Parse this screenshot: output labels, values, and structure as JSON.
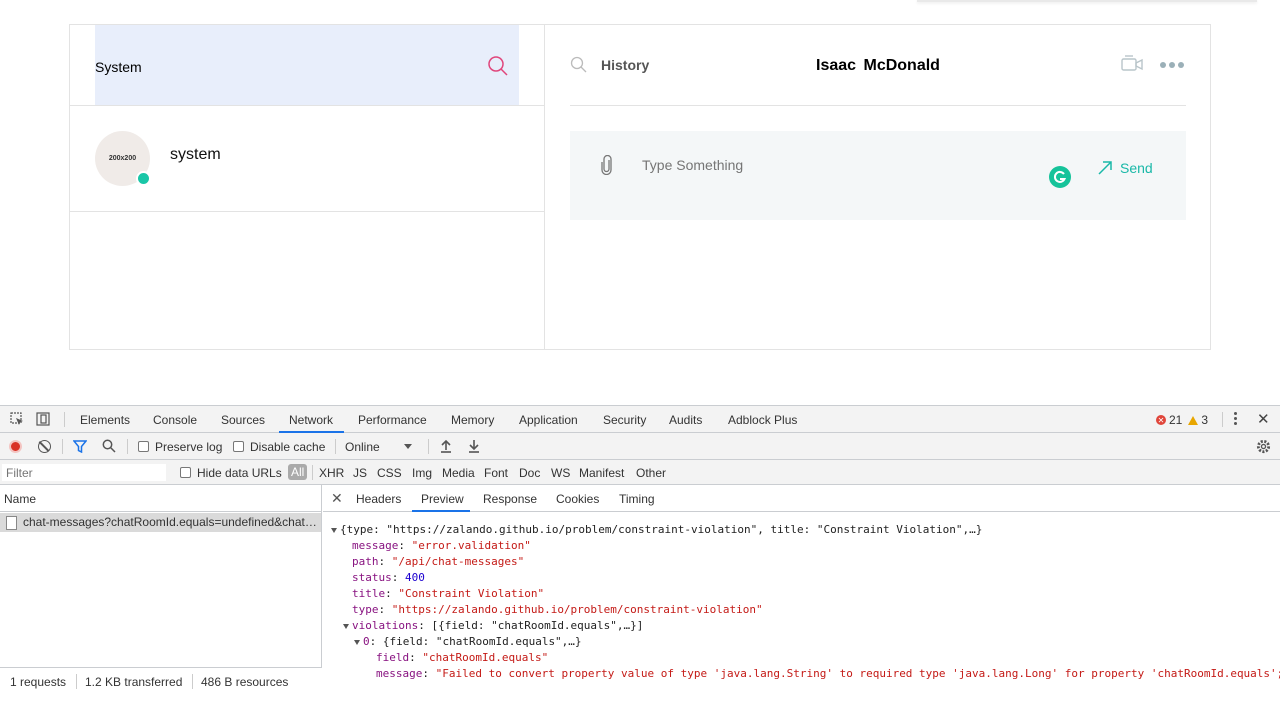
{
  "chat": {
    "search": {
      "value": "System"
    },
    "contact": {
      "avatar_text": "200x200",
      "name": "system"
    },
    "header": {
      "history_label": "History",
      "title": "Isaac  McDonald"
    },
    "composer": {
      "placeholder": "Type Something",
      "send_label": "Send"
    }
  },
  "devtools": {
    "tabs": [
      "Elements",
      "Console",
      "Sources",
      "Network",
      "Performance",
      "Memory",
      "Application",
      "Security",
      "Audits",
      "Adblock Plus"
    ],
    "active_tab": "Network",
    "errors": "21",
    "warnings": "3",
    "toolbar": {
      "preserve_log": "Preserve log",
      "disable_cache": "Disable cache",
      "throttle": "Online"
    },
    "filter": {
      "placeholder": "Filter",
      "hide_data_urls": "Hide data URLs",
      "types": [
        "All",
        "XHR",
        "JS",
        "CSS",
        "Img",
        "Media",
        "Font",
        "Doc",
        "WS",
        "Manifest",
        "Other"
      ]
    },
    "name_header": "Name",
    "request": "chat-messages?chatRoomId.equals=undefined&chatRoomId...",
    "status": {
      "requests": "1 requests",
      "transferred": "1.2 KB transferred",
      "resources": "486 B resources"
    },
    "detail_tabs": [
      "Headers",
      "Preview",
      "Response",
      "Cookies",
      "Timing"
    ],
    "active_detail_tab": "Preview",
    "preview": {
      "summary": "{type: \"https://zalando.github.io/problem/constraint-violation\", title: \"Constraint Violation\",…}",
      "message": "\"error.validation\"",
      "path": "\"/api/chat-messages\"",
      "status": "400",
      "title": "\"Constraint Violation\"",
      "type": "\"https://zalando.github.io/problem/constraint-violation\"",
      "violations_summary": "[{field: \"chatRoomId.equals\",…}]",
      "violation0_summary": "{field: \"chatRoomId.equals\",…}",
      "violation0_field": "\"chatRoomId.equals\"",
      "violation0_message": "\"Failed to convert property value of type 'java.lang.String' to required type 'java.lang.Long' for property 'chatRoomId.equals';"
    }
  }
}
